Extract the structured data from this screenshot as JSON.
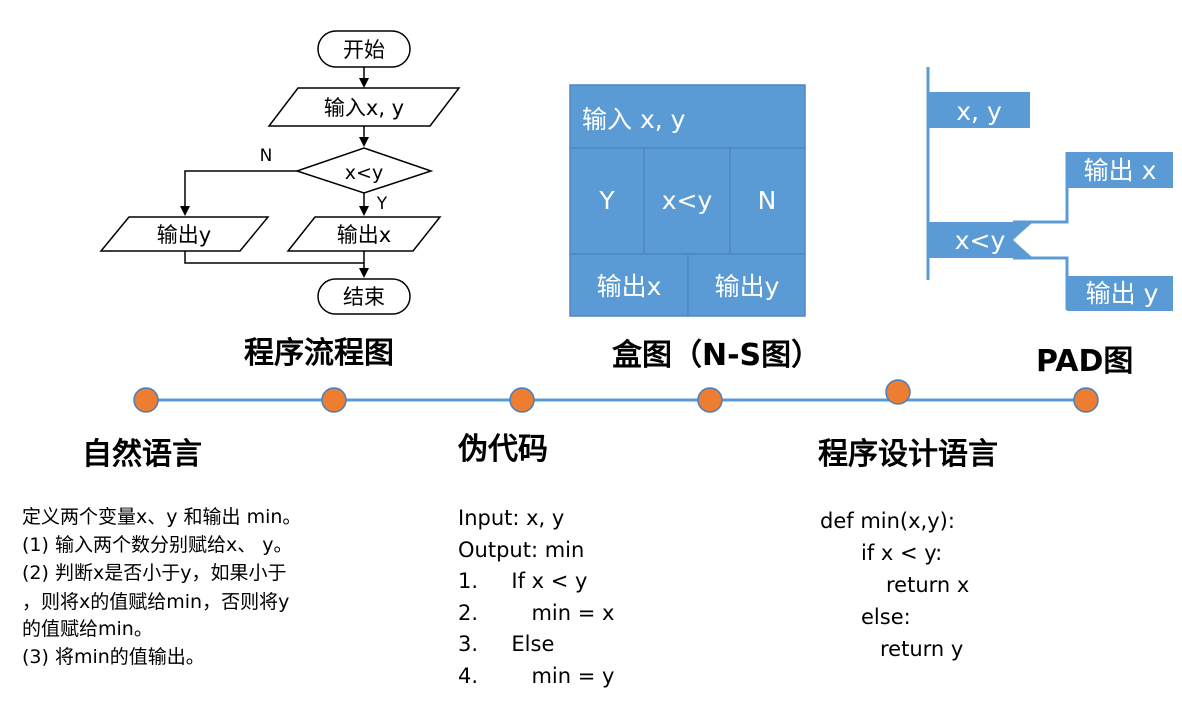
{
  "colors": {
    "accent_blue": "#5b9bd5",
    "timeline_line": "#5b9bd5",
    "dot_fill": "#ed7d31",
    "dot_stroke": "#4a7fbf",
    "ns_border": "#4f87c4"
  },
  "flowchart": {
    "start": "开始",
    "input": "输入x, y",
    "condition": "x<y",
    "no_label": "N",
    "yes_label": "Y",
    "output_left": "输出y",
    "output_right": "输出x",
    "end": "结束",
    "caption": "程序流程图"
  },
  "ns_diagram": {
    "input": "输入 x, y",
    "yes": "Y",
    "condition": "x<y",
    "no": "N",
    "output_left": "输出x",
    "output_right": "输出y",
    "caption": "盒图（N-S图）"
  },
  "pad_diagram": {
    "input": "x, y",
    "condition": "x<y",
    "output_top": "输出 x",
    "output_bottom": "输出 y",
    "caption": "PAD图"
  },
  "timeline": {
    "dot_count": 6
  },
  "sections": {
    "natural_language": {
      "title": "自然语言",
      "lines": [
        "定义两个变量x、y 和输出 min。",
        "(1) 输入两个数分别赋给x、 y。",
        "(2) 判断x是否小于y，如果小于",
        "，则将x的值赋给min，否则将y",
        "的值赋给min。",
        "(3) 将min的值输出。"
      ]
    },
    "pseudocode": {
      "title": "伪代码",
      "lines": [
        "Input: x, y",
        "Output: min",
        "1.     If x < y",
        "2.        min = x",
        "3.     Else",
        "4.        min = y"
      ]
    },
    "programming_language": {
      "title": "程序设计语言",
      "lines": [
        "def min(x,y):",
        "if x < y:",
        "return x",
        "else:",
        "return y"
      ]
    }
  }
}
